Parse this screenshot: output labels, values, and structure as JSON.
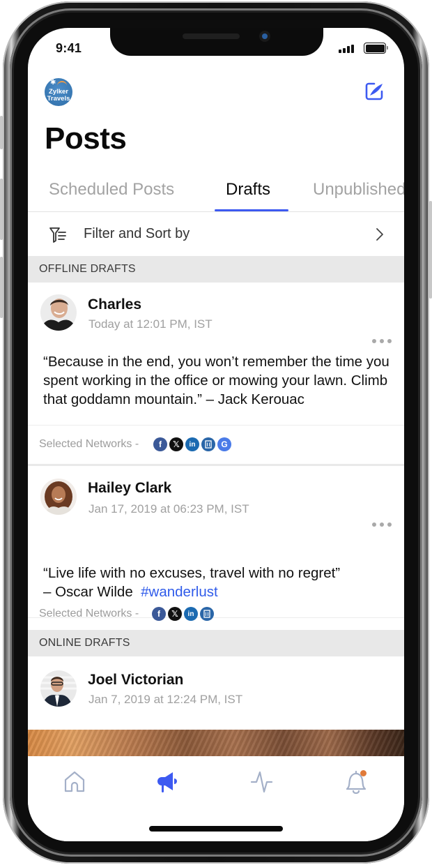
{
  "status_bar": {
    "time": "9:41"
  },
  "header": {
    "brand_logo_text": [
      "Zylker",
      "Travels"
    ],
    "compose_icon": "compose-icon",
    "title": "Posts"
  },
  "tabs": [
    {
      "label": "Scheduled Posts",
      "active": false
    },
    {
      "label": "Drafts",
      "active": true
    },
    {
      "label": "Unpublished",
      "active": false
    }
  ],
  "filter": {
    "label": "Filter and Sort by",
    "icon": "filter-icon",
    "chevron": "chevron-right-icon"
  },
  "sections": [
    {
      "title": "OFFLINE DRAFTS",
      "posts": [
        {
          "author": "Charles",
          "time": "Today at 12:01 PM, IST",
          "body": "“Because in the end, you won’t remember the time you spent working in the office or mowing your lawn. Climb that goddamn mountain.” – Jack Kerouac",
          "networks_label": "Selected Networks -",
          "networks": [
            "facebook",
            "x",
            "linkedin",
            "google-business",
            "google"
          ]
        },
        {
          "author": "Hailey Clark",
          "time": "Jan 17, 2019 at 06:23 PM, IST",
          "body_line1": "“Live life with no excuses, travel with no regret”",
          "body_line2": "– Oscar Wilde",
          "hashtag": "#wanderlust",
          "networks_label": "Selected Networks -",
          "networks": [
            "facebook",
            "x",
            "linkedin",
            "google-business"
          ]
        }
      ]
    },
    {
      "title": "ONLINE DRAFTS",
      "posts": [
        {
          "author": "Joel Victorian",
          "time": "Jan 7, 2019 at 12:24 PM, IST"
        }
      ]
    }
  ],
  "bottom_nav": [
    {
      "label": "Home",
      "icon": "home-icon",
      "active": false
    },
    {
      "label": "Posts",
      "icon": "megaphone-icon",
      "active": true
    },
    {
      "label": "Activity",
      "icon": "activity-icon",
      "active": false
    },
    {
      "label": "Notifications",
      "icon": "bell-icon",
      "active": false,
      "badge": true
    }
  ],
  "colors": {
    "accent": "#3d5af1",
    "hashtag": "#2f5bea",
    "nav_inactive": "#a4b0c8",
    "notification_dot": "#e07a3a",
    "section_bg": "#e8e8e8"
  }
}
